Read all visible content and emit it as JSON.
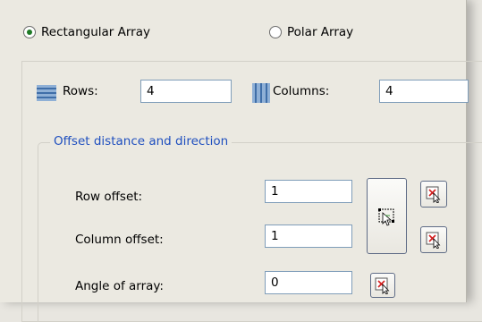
{
  "array_type": {
    "rectangular_label": "Rectangular Array",
    "polar_label": "Polar Array",
    "selected": "rectangular"
  },
  "grid": {
    "rows_label": "Rows:",
    "rows_value": "4",
    "columns_label": "Columns:",
    "columns_value": "4"
  },
  "offset": {
    "legend": "Offset distance and direction",
    "row_offset_label": "Row offset:",
    "row_offset_value": "1",
    "column_offset_label": "Column offset:",
    "column_offset_value": "1",
    "angle_label": "Angle of array:",
    "angle_value": "0"
  },
  "colors": {
    "accent_blue": "#1f4fbf",
    "radio_dot": "#1f7a26",
    "pick_red": "#d42020"
  }
}
